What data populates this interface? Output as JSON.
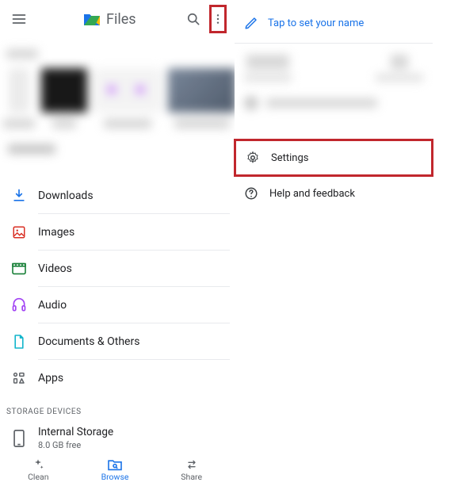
{
  "topbar": {
    "app_title": "Files"
  },
  "categories": [
    {
      "name": "downloads",
      "label": "Downloads",
      "icon_name": "download-icon",
      "color": "#1a73e8"
    },
    {
      "name": "images",
      "label": "Images",
      "icon_name": "image-icon",
      "color": "#d93025"
    },
    {
      "name": "videos",
      "label": "Videos",
      "icon_name": "video-icon",
      "color": "#188038"
    },
    {
      "name": "audio",
      "label": "Audio",
      "icon_name": "audio-icon",
      "color": "#a142f4"
    },
    {
      "name": "docs",
      "label": "Documents & Others",
      "icon_name": "document-icon",
      "color": "#12b5cb"
    },
    {
      "name": "apps",
      "label": "Apps",
      "icon_name": "apps-icon",
      "color": "#5f6368"
    }
  ],
  "storage": {
    "section_label": "STORAGE DEVICES",
    "internal": {
      "title": "Internal Storage",
      "subtitle": "8.0 GB free"
    }
  },
  "bottom_nav": {
    "clean": "Clean",
    "browse": "Browse",
    "share": "Share"
  },
  "panel": {
    "set_name_label": "Tap to set your name",
    "settings_label": "Settings",
    "help_label": "Help and feedback"
  }
}
